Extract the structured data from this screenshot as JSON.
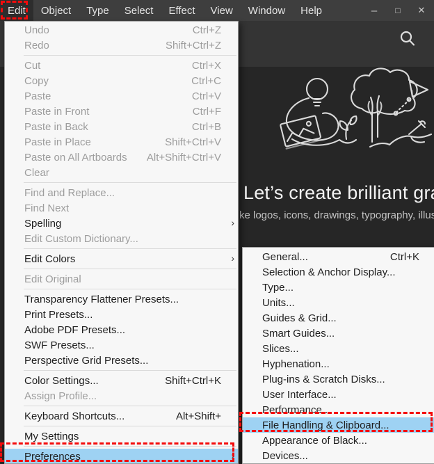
{
  "colors": {
    "highlight_blue": "#9ed2f3",
    "annotation_red": "#f40b0b",
    "menubar_bg": "#3e3e3e",
    "canvas_bg": "#262626",
    "panel_bg": "#f7f7f7"
  },
  "menubar": {
    "items": [
      {
        "label": "Edit",
        "active": true
      },
      {
        "label": "Object",
        "active": false
      },
      {
        "label": "Type",
        "active": false
      },
      {
        "label": "Select",
        "active": false
      },
      {
        "label": "Effect",
        "active": false
      },
      {
        "label": "View",
        "active": false
      },
      {
        "label": "Window",
        "active": false
      },
      {
        "label": "Help",
        "active": false
      }
    ],
    "window_controls": {
      "minimize": "–",
      "maximize": "□",
      "close": "✕"
    }
  },
  "hero": {
    "title": "Let’s create brilliant grap",
    "subtitle": "ke logos, icons, drawings, typography, illustratio",
    "search_icon": "magnifying-glass"
  },
  "edit_menu": {
    "items": [
      {
        "label": "Undo",
        "shortcut": "Ctrl+Z",
        "disabled": true
      },
      {
        "label": "Redo",
        "shortcut": "Shift+Ctrl+Z",
        "disabled": true
      },
      {
        "type": "separator"
      },
      {
        "label": "Cut",
        "shortcut": "Ctrl+X",
        "disabled": true
      },
      {
        "label": "Copy",
        "shortcut": "Ctrl+C",
        "disabled": true
      },
      {
        "label": "Paste",
        "shortcut": "Ctrl+V",
        "disabled": true
      },
      {
        "label": "Paste in Front",
        "shortcut": "Ctrl+F",
        "disabled": true
      },
      {
        "label": "Paste in Back",
        "shortcut": "Ctrl+B",
        "disabled": true
      },
      {
        "label": "Paste in Place",
        "shortcut": "Shift+Ctrl+V",
        "disabled": true
      },
      {
        "label": "Paste on All Artboards",
        "shortcut": "Alt+Shift+Ctrl+V",
        "disabled": true
      },
      {
        "label": "Clear",
        "disabled": true
      },
      {
        "type": "separator"
      },
      {
        "label": "Find and Replace...",
        "disabled": true
      },
      {
        "label": "Find Next",
        "disabled": true
      },
      {
        "label": "Spelling",
        "submenu": true
      },
      {
        "label": "Edit Custom Dictionary...",
        "disabled": true
      },
      {
        "type": "separator"
      },
      {
        "label": "Edit Colors",
        "submenu": true
      },
      {
        "type": "separator"
      },
      {
        "label": "Edit Original",
        "disabled": true
      },
      {
        "type": "separator"
      },
      {
        "label": "Transparency Flattener Presets..."
      },
      {
        "label": "Print Presets..."
      },
      {
        "label": "Adobe PDF Presets..."
      },
      {
        "label": "SWF Presets..."
      },
      {
        "label": "Perspective Grid Presets..."
      },
      {
        "type": "separator"
      },
      {
        "label": "Color Settings...",
        "shortcut": "Shift+Ctrl+K"
      },
      {
        "label": "Assign Profile...",
        "disabled": true
      },
      {
        "type": "separator"
      },
      {
        "label": "Keyboard Shortcuts...",
        "shortcut": "Alt+Shift+"
      },
      {
        "type": "separator"
      },
      {
        "label": "My Settings"
      },
      {
        "type": "separator"
      },
      {
        "label": "Preferences",
        "submenu": true,
        "highlighted": true
      }
    ]
  },
  "preferences_submenu": {
    "items": [
      {
        "label": "General...",
        "shortcut": "Ctrl+K"
      },
      {
        "label": "Selection & Anchor Display..."
      },
      {
        "label": "Type..."
      },
      {
        "label": "Units..."
      },
      {
        "label": "Guides & Grid..."
      },
      {
        "label": "Smart Guides..."
      },
      {
        "label": "Slices..."
      },
      {
        "label": "Hyphenation..."
      },
      {
        "label": "Plug-ins & Scratch Disks..."
      },
      {
        "label": "User Interface..."
      },
      {
        "label": "Performance..."
      },
      {
        "label": "File Handling & Clipboard...",
        "highlighted": true
      },
      {
        "label": "Appearance of Black..."
      },
      {
        "label": "Devices..."
      }
    ]
  },
  "annotations": {
    "boxes": [
      {
        "target": "menubar-item-edit"
      },
      {
        "target": "menu-item-preferences"
      },
      {
        "target": "menu-item-file-handling-clipboard"
      }
    ]
  }
}
